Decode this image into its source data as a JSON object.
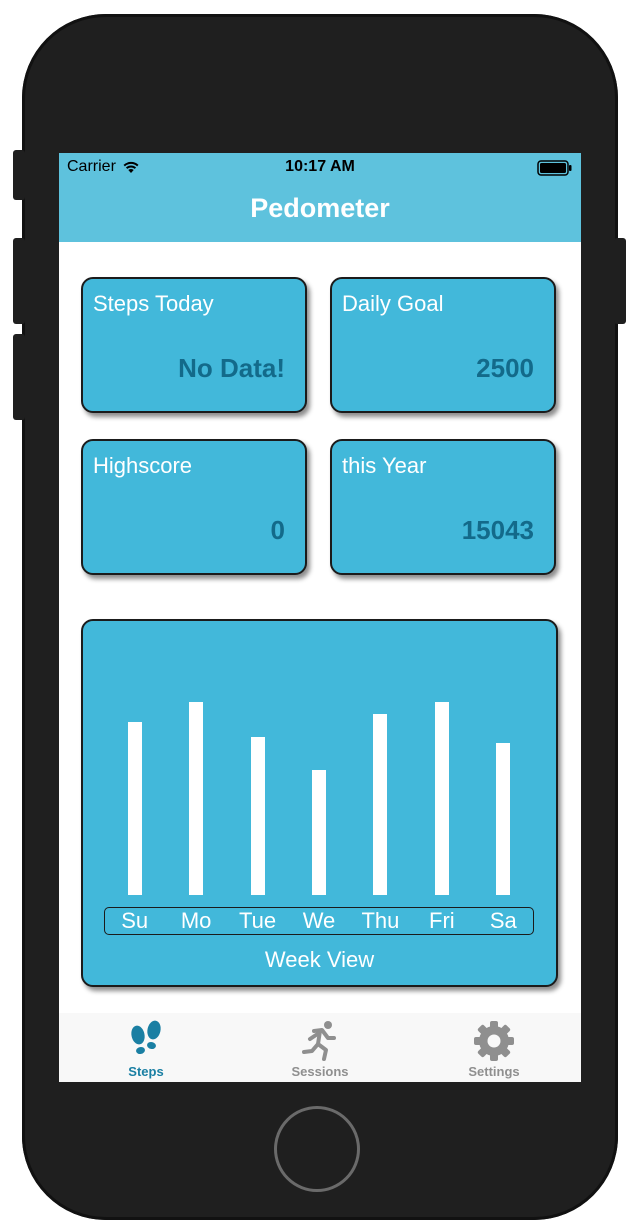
{
  "status_bar": {
    "carrier": "Carrier",
    "time": "10:17 AM",
    "wifi_icon": "wifi-icon",
    "battery_icon": "battery-icon"
  },
  "nav": {
    "title": "Pedometer"
  },
  "stats": {
    "steps_today": {
      "label": "Steps Today",
      "value": "No Data!"
    },
    "daily_goal": {
      "label": "Daily Goal",
      "value": "2500"
    },
    "highscore": {
      "label": "Highscore",
      "value": "0"
    },
    "this_year": {
      "label": "this Year",
      "value": "15043"
    }
  },
  "week_view": {
    "title": "Week View",
    "days": [
      "Su",
      "Mo",
      "Tue",
      "We",
      "Thu",
      "Fri",
      "Sa"
    ],
    "bar_levels": [
      0.83,
      0.93,
      0.76,
      0.6,
      0.87,
      0.93,
      0.73
    ]
  },
  "tab_bar": {
    "tabs": [
      {
        "label": "Steps",
        "icon": "footprints-icon",
        "active": true
      },
      {
        "label": "Sessions",
        "icon": "running-person-icon",
        "active": false
      },
      {
        "label": "Settings",
        "icon": "gear-icon",
        "active": false
      }
    ]
  },
  "colors": {
    "nav_background": "#5ec2dd",
    "card_background": "#42b8da",
    "value_text": "#136a8a",
    "active_tab": "#1a7fa3",
    "inactive_tab": "#8f8f8f",
    "device_body": "#1f1f1f"
  }
}
